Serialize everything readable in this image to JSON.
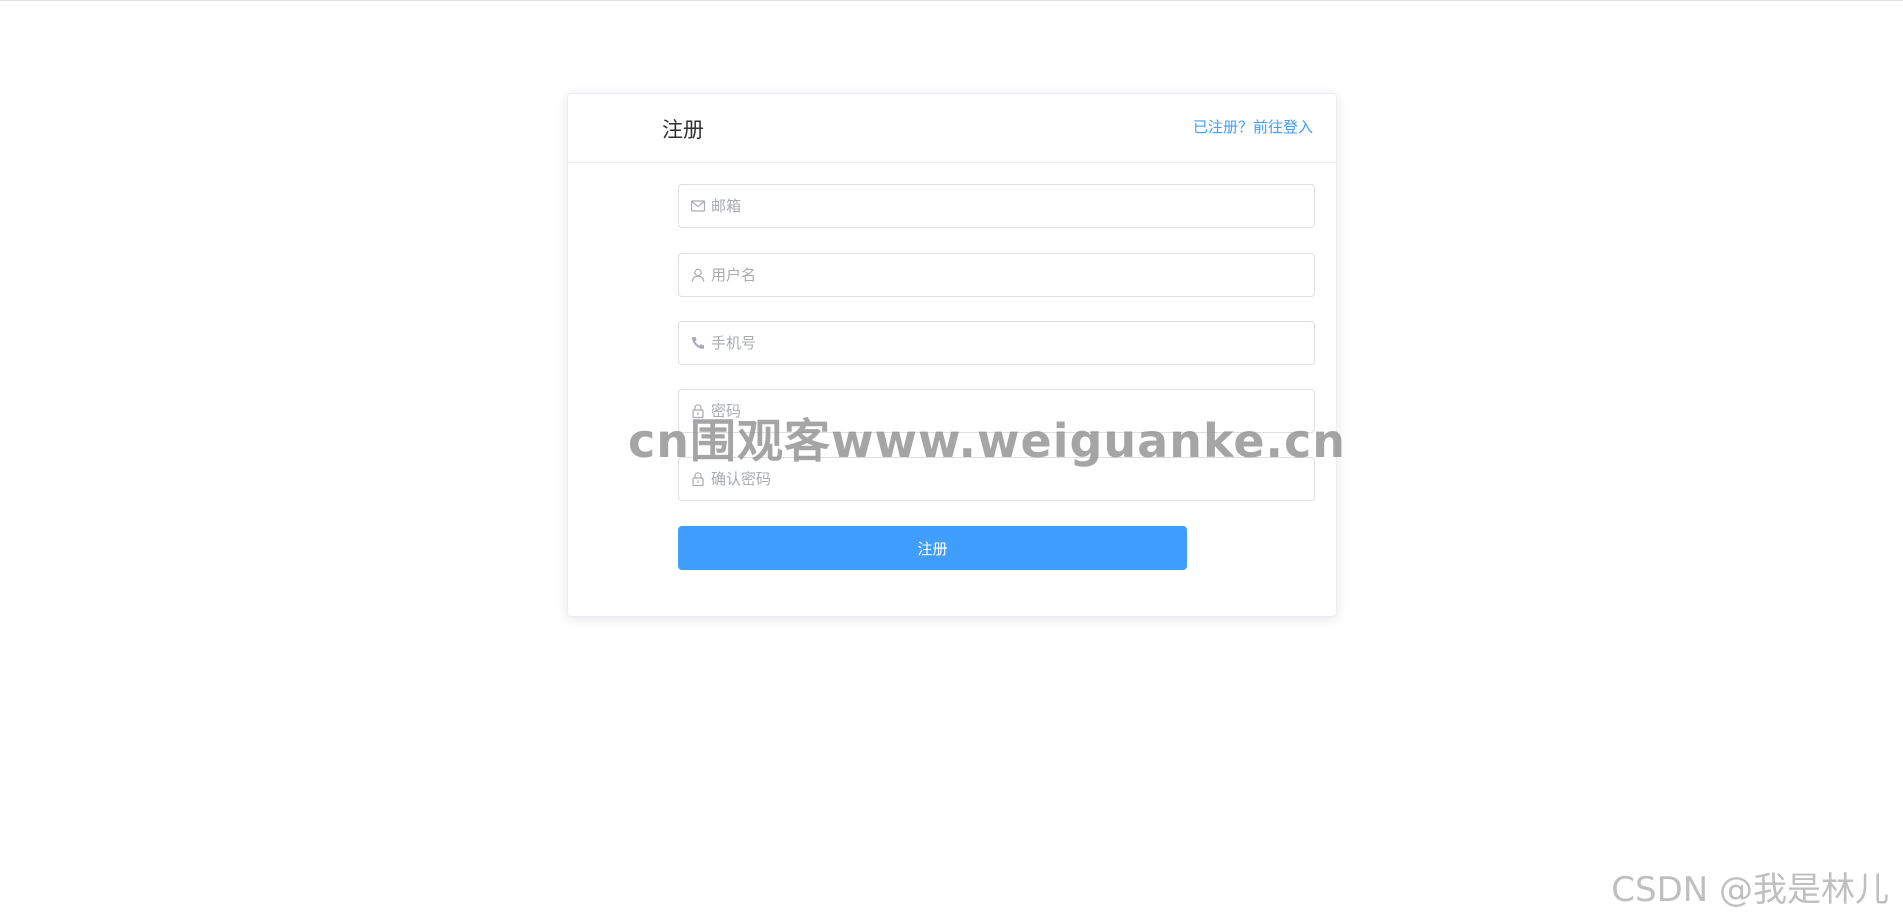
{
  "form": {
    "title": "注册",
    "login_link": "已注册？前往登入",
    "fields": [
      {
        "icon": "mail-icon",
        "placeholder": "邮箱",
        "value": ""
      },
      {
        "icon": "user-icon",
        "placeholder": "用户名",
        "value": ""
      },
      {
        "icon": "phone-icon",
        "placeholder": "手机号",
        "value": ""
      },
      {
        "icon": "lock-icon",
        "placeholder": "密码",
        "value": ""
      },
      {
        "icon": "lock-icon",
        "placeholder": "确认密码",
        "value": ""
      }
    ],
    "submit_label": "注册"
  },
  "watermarks": {
    "site": "cn围观客www.weiguanke.cn",
    "author": "CSDN @我是林儿"
  },
  "colors": {
    "primary": "#409eff",
    "border": "#dcdfe6",
    "placeholder": "#a8abb2",
    "title": "#303133"
  }
}
